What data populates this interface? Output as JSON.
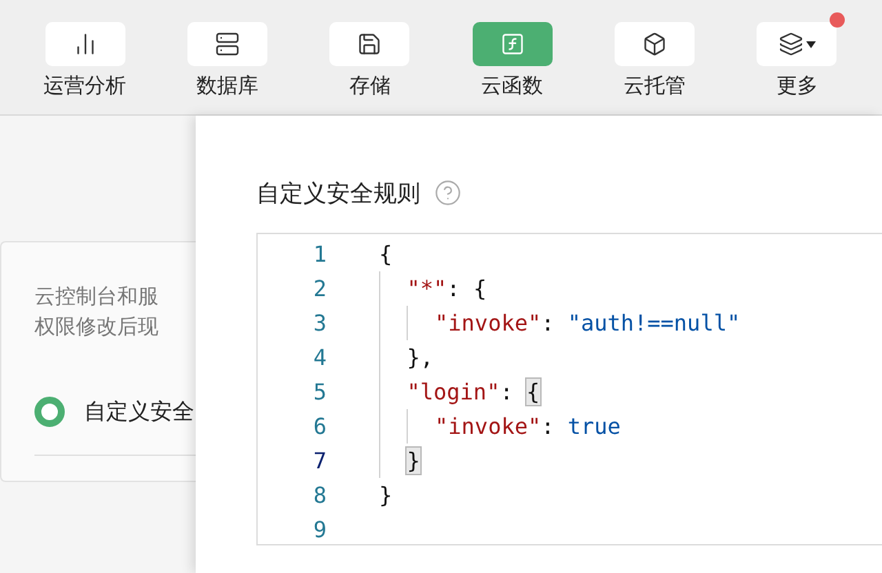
{
  "toolbar": [
    {
      "label": "运营分析",
      "kind": "page",
      "selected": false
    },
    {
      "label": "数据库",
      "kind": "page",
      "selected": false
    },
    {
      "label": "存储",
      "kind": "page",
      "selected": false
    },
    {
      "label": "云函数",
      "kind": "page",
      "selected": true
    },
    {
      "label": "云托管",
      "kind": "page",
      "selected": false
    },
    {
      "label": "更多",
      "kind": "menu",
      "selected": false
    }
  ],
  "card": {
    "lines": [
      "云控制台和服",
      "权限修改后现"
    ],
    "option": {
      "label": "自定义安全",
      "selected": true
    }
  },
  "panel": {
    "title": "自定义安全规则",
    "editor": {
      "lines": [
        {
          "number": "1",
          "current": false,
          "tokens": [
            {
              "kind": "punct",
              "text": "{",
              "matched": false
            }
          ]
        },
        {
          "number": "2",
          "current": false,
          "tokens": [
            {
              "kind": "key",
              "text": "  \"*\"",
              "matched": false
            },
            {
              "kind": "punct",
              "text": ": {",
              "matched": false
            }
          ]
        },
        {
          "number": "3",
          "current": false,
          "tokens": [
            {
              "kind": "key",
              "text": "    \"invoke\"",
              "matched": false
            },
            {
              "kind": "punct",
              "text": ": ",
              "matched": false
            },
            {
              "kind": "string",
              "text": "\"auth!==null\"",
              "matched": false
            }
          ]
        },
        {
          "number": "4",
          "current": false,
          "tokens": [
            {
              "kind": "punct",
              "text": "  },",
              "matched": false
            }
          ]
        },
        {
          "number": "5",
          "current": false,
          "tokens": [
            {
              "kind": "key",
              "text": "  \"login\"",
              "matched": false
            },
            {
              "kind": "punct",
              "text": ": ",
              "matched": false
            },
            {
              "kind": "punct",
              "text": "{",
              "matched": true
            }
          ]
        },
        {
          "number": "6",
          "current": false,
          "tokens": [
            {
              "kind": "key",
              "text": "    \"invoke\"",
              "matched": false
            },
            {
              "kind": "punct",
              "text": ": ",
              "matched": false
            },
            {
              "kind": "bool",
              "text": "true",
              "matched": false
            }
          ]
        },
        {
          "number": "7",
          "current": true,
          "tokens": [
            {
              "kind": "punct",
              "text": "  }",
              "matched": true
            }
          ]
        },
        {
          "number": "8",
          "current": false,
          "tokens": [
            {
              "kind": "punct",
              "text": "}",
              "matched": false
            }
          ]
        },
        {
          "number": "9",
          "current": false
        }
      ]
    }
  }
}
